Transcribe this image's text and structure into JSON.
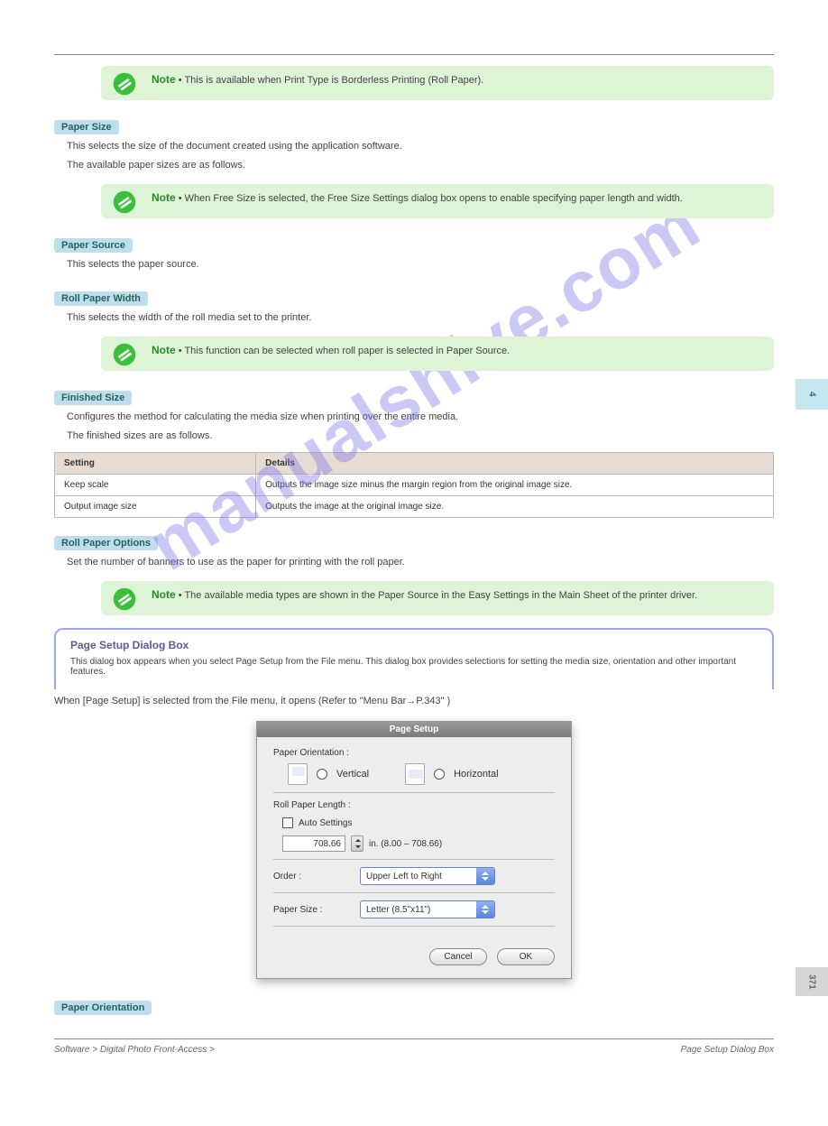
{
  "watermark": "manualshive.com",
  "side_tab_main": "4",
  "side_tab_secondary": "371",
  "notes": {
    "note1_label": "Note",
    "note1_text": "• This is available when Print Type is Borderless Printing (Roll Paper).",
    "note2_label": "Note",
    "note2_text": "• When Free Size is selected, the Free Size Settings dialog box opens to enable specifying paper length and width.",
    "note3_label": "Note",
    "note3_text": "• This function can be selected when roll paper is selected in Paper Source.",
    "note4_label": "Note",
    "note4_text": "• The available media types are shown in the Paper Source in the Easy Settings in the Main Sheet of the printer driver."
  },
  "headings": {
    "h1": "Paper Size",
    "h2": "Paper Source",
    "h3": "Roll Paper Width",
    "h4": "Finished Size",
    "h5": "Roll Paper Options",
    "h6": "Paper Orientation"
  },
  "paras": {
    "p1": "This selects the size of the document created using the application software.",
    "p1b": "The available paper sizes are as follows.",
    "p2": "This selects the paper source.",
    "p3": "This selects the width of the roll media set to the printer.",
    "p4": "Configures the method for calculating the media size when printing over the entire media.",
    "p5": "The finished sizes are as follows.",
    "p6": "Set the number of banners to use as the paper for printing with the roll paper.",
    "p7": "When [Page Setup] is selected from the File menu, it opens (Refer to \"Menu Bar→P.343\" )"
  },
  "table": {
    "h_setting": "Setting",
    "h_details": "Details",
    "r1_setting": "Keep scale",
    "r1_details": "Outputs the image size minus the margin region from the original image size.",
    "r2_setting": "Output image size",
    "r2_details": "Outputs the image at the original image size."
  },
  "section": {
    "title": "Page Setup Dialog Box",
    "sub": "This dialog box appears when you select Page Setup from the File menu. This dialog box provides selections for setting the media size, orientation and other important features."
  },
  "dialog": {
    "title": "Page Setup",
    "paper_orientation_label": "Paper Orientation :",
    "vertical": "Vertical",
    "horizontal": "Horizontal",
    "roll_paper_length_label": "Roll Paper Length :",
    "auto_settings": "Auto Settings",
    "length_value": "708.66",
    "length_hint": "in. (8.00 – 708.66)",
    "order_label": "Order :",
    "order_value": "Upper Left to Right",
    "paper_size_label": "Paper Size :",
    "paper_size_value": "Letter (8.5\"x11\")",
    "cancel": "Cancel",
    "ok": "OK"
  },
  "footer": {
    "left": "Software  >  Digital Photo Front-Access  >",
    "right": "Page Setup Dialog Box"
  }
}
